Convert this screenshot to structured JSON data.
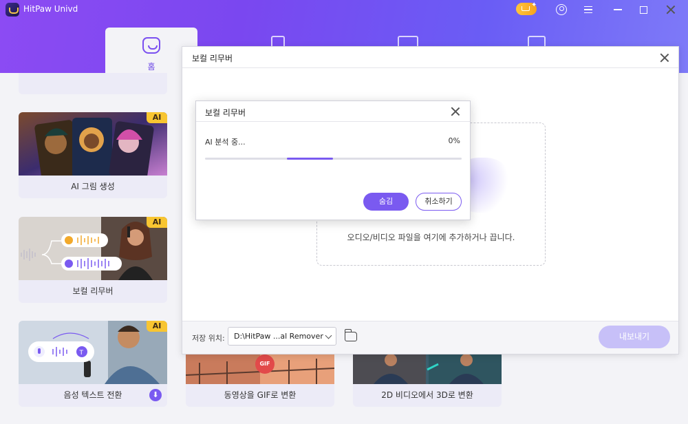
{
  "app": {
    "name": "HitPaw Univd"
  },
  "nav": {
    "home_label": "홈"
  },
  "cards": [
    {
      "label": "AI 그림 생성",
      "badge": "AI"
    },
    {
      "label": "보컬 리무버",
      "badge": "AI"
    },
    {
      "label": "음성 텍스트 전환",
      "badge": "AI"
    },
    {
      "label": "동영상을 GIF로 변환",
      "badge": "GIF"
    },
    {
      "label": "2D 비디오에서 3D로 변환"
    }
  ],
  "panel": {
    "title": "보컬 리무버",
    "drop_text": "오디오/비디오 파일을 여기에 추가하거나 끕니다.",
    "save_label": "저장 위치:",
    "save_path": "D:\\HitPaw ...al Remover",
    "export_label": "내보내기"
  },
  "dialog": {
    "title": "보컬 리무버",
    "status": "AI 분석 중...",
    "percent_text": "0%",
    "progress_fraction": 0.0,
    "hide_label": "숨김",
    "cancel_label": "취소하기"
  },
  "colors": {
    "accent": "#7a5af0",
    "header_start": "#8c4bf3",
    "header_end": "#7e7af8",
    "badge": "#f8c531"
  }
}
